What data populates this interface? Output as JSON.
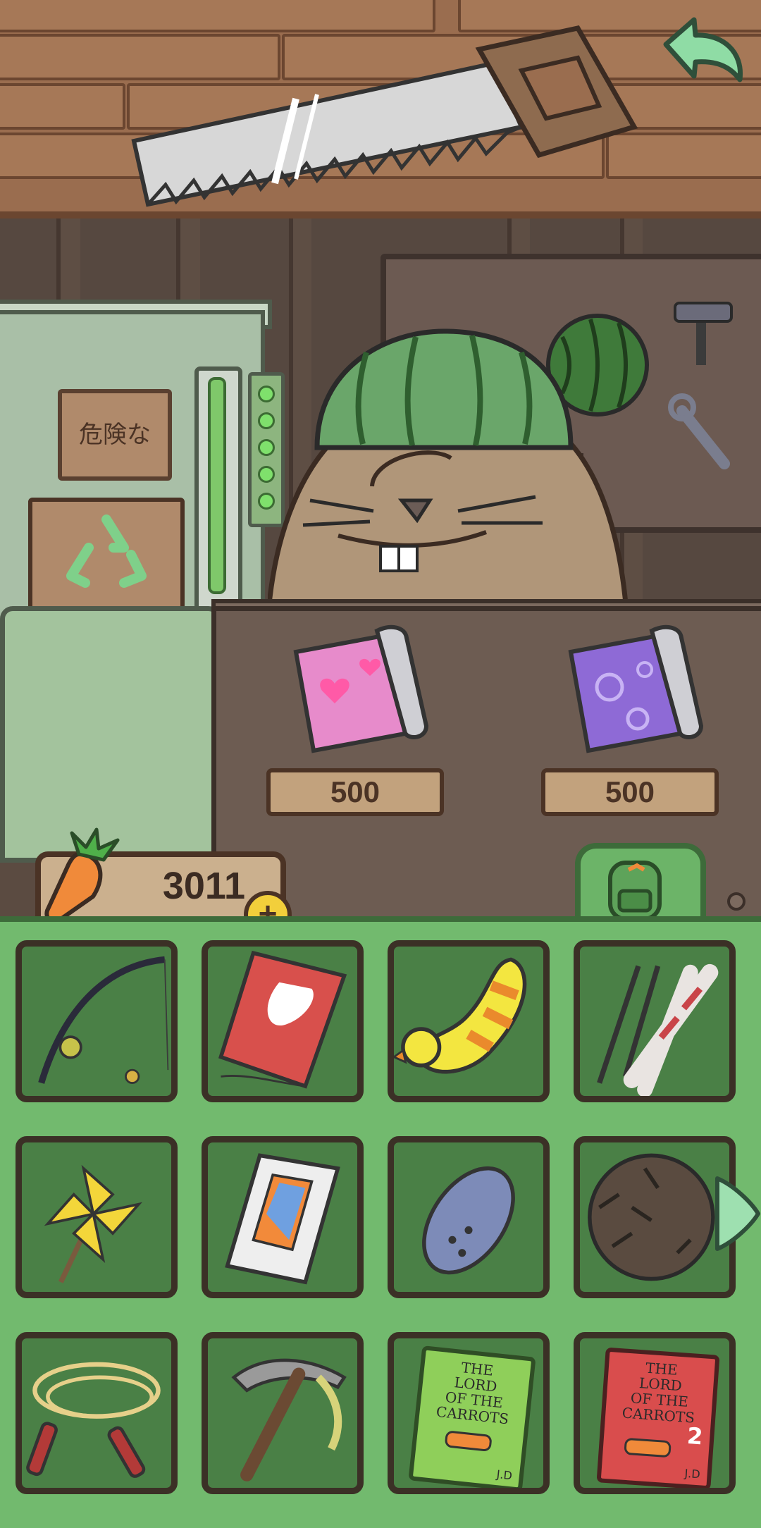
{
  "shop": {
    "sign_text": "危険な",
    "items": [
      {
        "name": "pink heart wallpaper",
        "price": "500",
        "color": "#e78bcb"
      },
      {
        "name": "purple sakura wallpaper",
        "price": "500",
        "color": "#8e6ad6"
      }
    ]
  },
  "currency": {
    "carrots": "3011",
    "add_label": "+"
  },
  "inventory": {
    "items": [
      {
        "name": "fishing rod",
        "icon": "fishing-rod-icon"
      },
      {
        "name": "kite",
        "icon": "kite-icon"
      },
      {
        "name": "duck swim ring",
        "icon": "duck-float-icon"
      },
      {
        "name": "skis",
        "icon": "skis-icon"
      },
      {
        "name": "pinwheel",
        "icon": "pinwheel-icon"
      },
      {
        "name": "phone box",
        "icon": "phone-box-icon"
      },
      {
        "name": "remote",
        "icon": "remote-icon"
      },
      {
        "name": "fur hat",
        "icon": "fur-hat-icon"
      },
      {
        "name": "jump rope",
        "icon": "jump-rope-icon"
      },
      {
        "name": "pickaxe",
        "icon": "pickaxe-icon"
      },
      {
        "name": "book",
        "icon": "book-1-icon",
        "title_lines": [
          "THE",
          "LORD",
          "OF THE",
          "CARROTS"
        ],
        "author": "J.D"
      },
      {
        "name": "book",
        "icon": "book-2-icon",
        "title_lines": [
          "THE",
          "LORD",
          "OF THE",
          "CARROTS"
        ],
        "volume": "2",
        "author": "J.D"
      }
    ]
  },
  "colors": {
    "inventory_bg": "#72ba6e",
    "slot_bg": "#4a8046",
    "accent_mint": "#9ee0b0"
  }
}
